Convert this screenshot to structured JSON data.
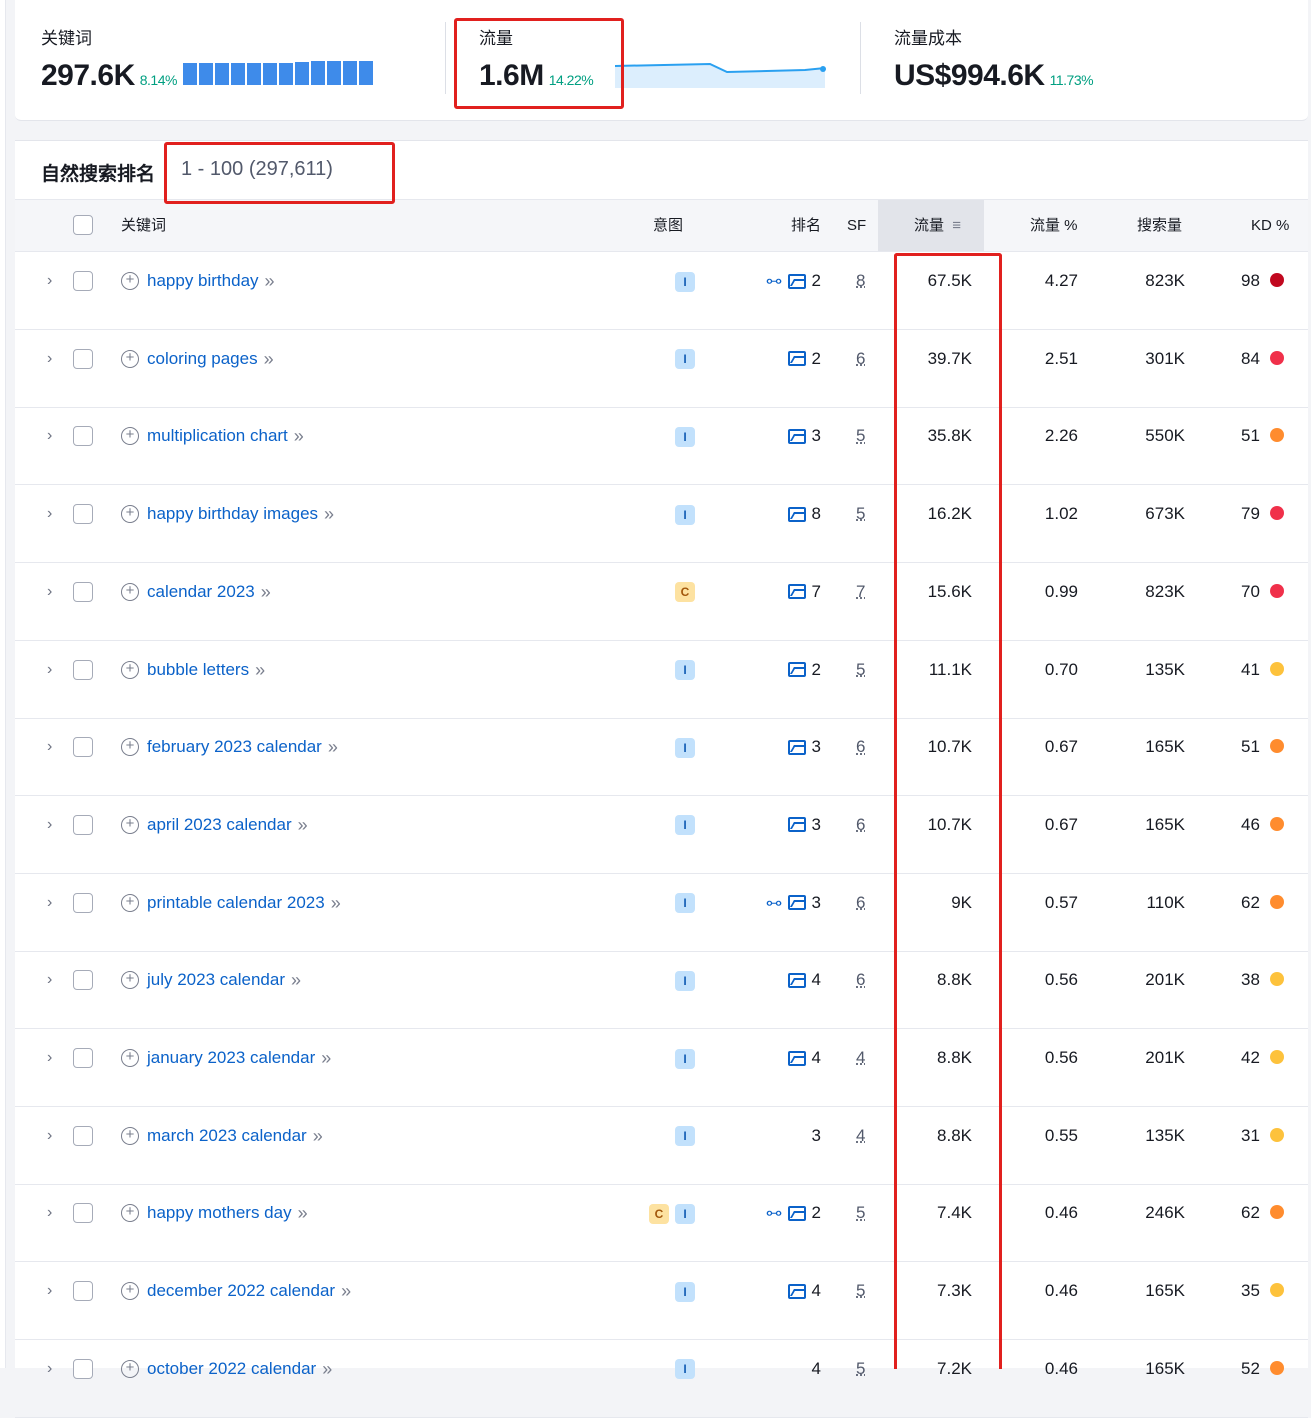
{
  "metrics": {
    "keywords": {
      "label": "关键词",
      "value": "297.6K",
      "change": "8.14%"
    },
    "traffic": {
      "label": "流量",
      "value": "1.6M",
      "change": "14.22%"
    },
    "traffic_cost": {
      "label": "流量成本",
      "value": "US$994.6K",
      "change": "11.73%"
    }
  },
  "table": {
    "title": "自然搜索排名",
    "range": "1 - 100 (297,611)",
    "headers": {
      "keyword": "关键词",
      "intent": "意图",
      "position": "排名",
      "sf": "SF",
      "traffic": "流量",
      "traffic_pct": "流量 %",
      "volume": "搜索量",
      "kd": "KD %"
    },
    "rows": [
      {
        "keyword": "happy birthday",
        "intent": [
          "I"
        ],
        "link": true,
        "image": true,
        "position": "2",
        "sf": "8",
        "traffic": "67.5K",
        "traffic_pct": "4.27",
        "volume": "823K",
        "kd": "98",
        "kd_color": "#c1081f"
      },
      {
        "keyword": "coloring pages",
        "intent": [
          "I"
        ],
        "link": false,
        "image": true,
        "position": "2",
        "sf": "6",
        "traffic": "39.7K",
        "traffic_pct": "2.51",
        "volume": "301K",
        "kd": "84",
        "kd_color": "#f0304a"
      },
      {
        "keyword": "multiplication chart",
        "intent": [
          "I"
        ],
        "link": false,
        "image": true,
        "position": "3",
        "sf": "5",
        "traffic": "35.8K",
        "traffic_pct": "2.26",
        "volume": "550K",
        "kd": "51",
        "kd_color": "#ff8c2e"
      },
      {
        "keyword": "happy birthday images",
        "intent": [
          "I"
        ],
        "link": false,
        "image": true,
        "position": "8",
        "sf": "5",
        "traffic": "16.2K",
        "traffic_pct": "1.02",
        "volume": "673K",
        "kd": "79",
        "kd_color": "#f0304a"
      },
      {
        "keyword": "calendar 2023",
        "intent": [
          "C"
        ],
        "link": false,
        "image": true,
        "position": "7",
        "sf": "7",
        "traffic": "15.6K",
        "traffic_pct": "0.99",
        "volume": "823K",
        "kd": "70",
        "kd_color": "#f0304a"
      },
      {
        "keyword": "bubble letters",
        "intent": [
          "I"
        ],
        "link": false,
        "image": true,
        "position": "2",
        "sf": "5",
        "traffic": "11.1K",
        "traffic_pct": "0.70",
        "volume": "135K",
        "kd": "41",
        "kd_color": "#fdc23c"
      },
      {
        "keyword": "february 2023 calendar",
        "intent": [
          "I"
        ],
        "link": false,
        "image": true,
        "position": "3",
        "sf": "6",
        "traffic": "10.7K",
        "traffic_pct": "0.67",
        "volume": "165K",
        "kd": "51",
        "kd_color": "#ff8c2e"
      },
      {
        "keyword": "april 2023 calendar",
        "intent": [
          "I"
        ],
        "link": false,
        "image": true,
        "position": "3",
        "sf": "6",
        "traffic": "10.7K",
        "traffic_pct": "0.67",
        "volume": "165K",
        "kd": "46",
        "kd_color": "#ff8c2e"
      },
      {
        "keyword": "printable calendar 2023",
        "intent": [
          "I"
        ],
        "link": true,
        "image": true,
        "position": "3",
        "sf": "6",
        "traffic": "9K",
        "traffic_pct": "0.57",
        "volume": "110K",
        "kd": "62",
        "kd_color": "#ff8c2e"
      },
      {
        "keyword": "july 2023 calendar",
        "intent": [
          "I"
        ],
        "link": false,
        "image": true,
        "position": "4",
        "sf": "6",
        "traffic": "8.8K",
        "traffic_pct": "0.56",
        "volume": "201K",
        "kd": "38",
        "kd_color": "#fdc23c"
      },
      {
        "keyword": "january 2023 calendar",
        "intent": [
          "I"
        ],
        "link": false,
        "image": true,
        "position": "4",
        "sf": "4",
        "traffic": "8.8K",
        "traffic_pct": "0.56",
        "volume": "201K",
        "kd": "42",
        "kd_color": "#fdc23c"
      },
      {
        "keyword": "march 2023 calendar",
        "intent": [
          "I"
        ],
        "link": false,
        "image": false,
        "position": "3",
        "sf": "4",
        "traffic": "8.8K",
        "traffic_pct": "0.55",
        "volume": "135K",
        "kd": "31",
        "kd_color": "#fdc23c"
      },
      {
        "keyword": "happy mothers day",
        "intent": [
          "C",
          "I"
        ],
        "link": true,
        "image": true,
        "position": "2",
        "sf": "5",
        "traffic": "7.4K",
        "traffic_pct": "0.46",
        "volume": "246K",
        "kd": "62",
        "kd_color": "#ff8c2e"
      },
      {
        "keyword": "december 2022 calendar",
        "intent": [
          "I"
        ],
        "link": false,
        "image": true,
        "position": "4",
        "sf": "5",
        "traffic": "7.3K",
        "traffic_pct": "0.46",
        "volume": "165K",
        "kd": "35",
        "kd_color": "#fdc23c"
      },
      {
        "keyword": "october 2022 calendar",
        "intent": [
          "I"
        ],
        "link": false,
        "image": false,
        "position": "4",
        "sf": "5",
        "traffic": "7.2K",
        "traffic_pct": "0.46",
        "volume": "165K",
        "kd": "52",
        "kd_color": "#ff8c2e"
      }
    ]
  },
  "icons": {
    "expand": "chevron-right-icon",
    "add": "plus-circle-icon",
    "open": "double-chevron-right-icon",
    "link": "link-icon",
    "image": "image-icon",
    "sort": "sort-icon"
  },
  "colors": {
    "accent": "#0b62c9",
    "positive": "#009f81",
    "highlight": "#e1201e",
    "bar": "#3e8bea"
  }
}
